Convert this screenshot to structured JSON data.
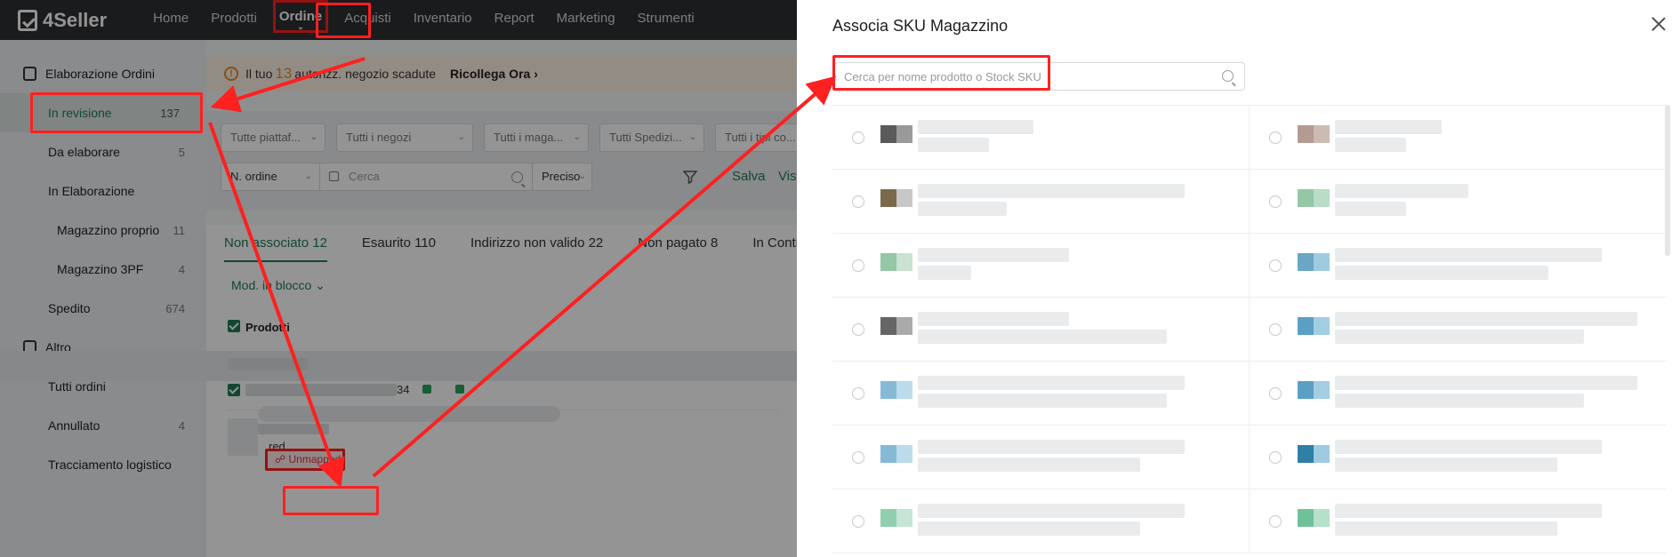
{
  "app": {
    "brand": "4Seller"
  },
  "nav": {
    "items": [
      "Home",
      "Prodotti",
      "Ordine",
      "Acquisti",
      "Inventario",
      "Report",
      "Marketing",
      "Strumenti"
    ],
    "active": "Ordine"
  },
  "sidebar": {
    "group1": "Elaborazione Ordini",
    "items": [
      {
        "label": "In revisione",
        "count": "137"
      },
      {
        "label": "Da elaborare",
        "count": "5"
      },
      {
        "label": "In Elaborazione",
        "count": ""
      },
      {
        "label": "Magazzino proprio",
        "count": "11"
      },
      {
        "label": "Magazzino 3PF",
        "count": "4"
      },
      {
        "label": "Spedito",
        "count": "674"
      }
    ],
    "group2": "Altro",
    "items2": [
      {
        "label": "Tutti ordini",
        "count": ""
      },
      {
        "label": "Annullato",
        "count": "4"
      },
      {
        "label": "Tracciamento logistico",
        "count": ""
      }
    ]
  },
  "alert": {
    "prefix": "Il tuo",
    "number": "13",
    "suffix": "autorizz. negozio scadute",
    "action": "Ricollega Ora"
  },
  "filters": {
    "platform": "Tutte piattaf...",
    "shops": "Tutti i negozi",
    "warehouse": "Tutti i maga...",
    "shipping": "Tutti Spedizi...",
    "types": "Tutti i tipi co...",
    "search_field": "N. ordine",
    "search_placeholder": "Cerca",
    "match_mode": "Preciso",
    "save": "Salva",
    "view": "Vis"
  },
  "tabs": [
    "Non associato 12",
    "Esaurito 110",
    "Indirizzo non valido 22",
    "Non pagato 8",
    "In Contr"
  ],
  "content": {
    "bulk_edit": "Mod. in blocco",
    "products_header": "Prodotti",
    "order_suffix": "34",
    "variant": "red",
    "unmapped": "Unmapped"
  },
  "drawer": {
    "title": "Associa SKU Magazzino",
    "search_placeholder": "Cerca per nome prodotto o Stock SKU",
    "search_value": ""
  },
  "colors": {
    "accent": "#1f7a57",
    "highlight": "#ff2020",
    "topbar": "#2e3033",
    "warning": "#e58a2c"
  }
}
